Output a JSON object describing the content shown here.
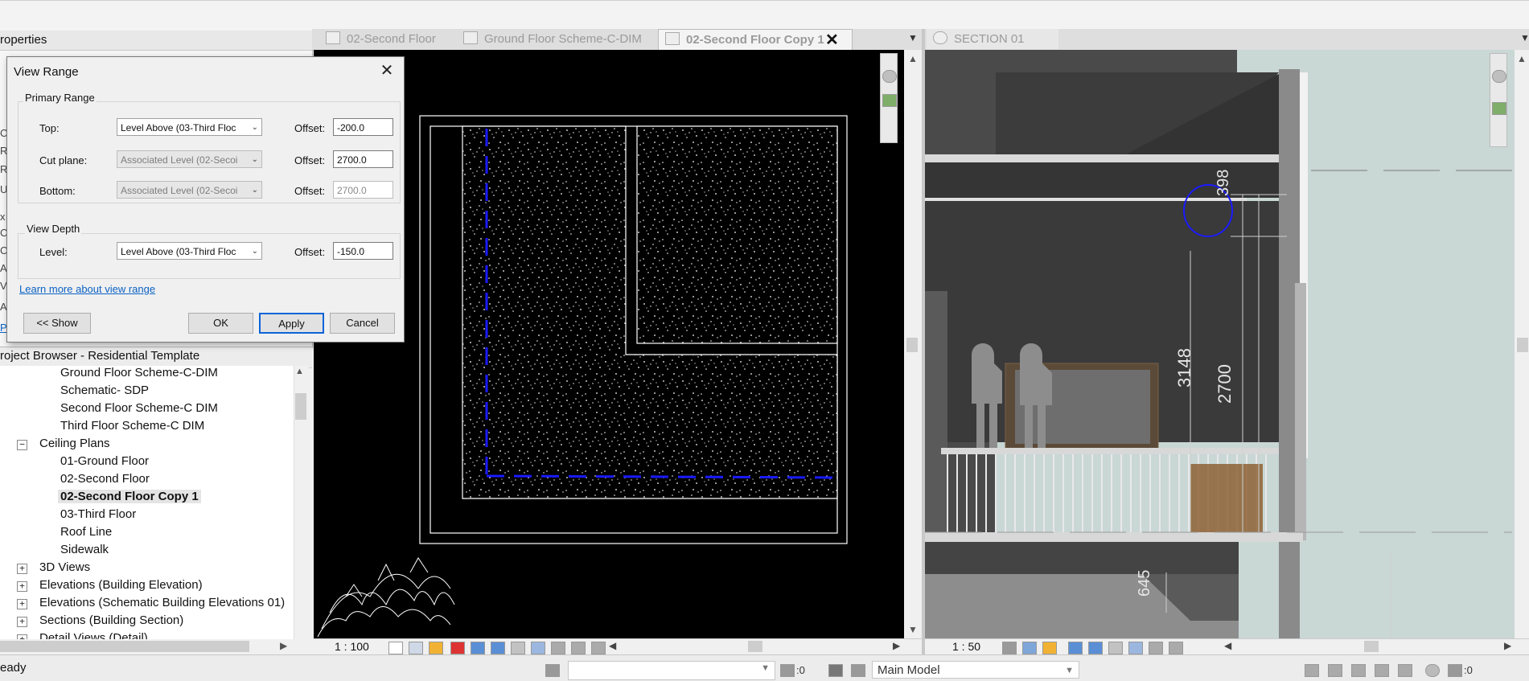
{
  "properties": {
    "title": "roperties",
    "left_letters": [
      "Ce",
      "R",
      "R",
      "U",
      "x",
      "C",
      "C",
      "A",
      "V",
      "A",
      "Pr"
    ]
  },
  "dialog": {
    "title": "View Range",
    "close_glyph": "✕",
    "primary_range": {
      "label": "Primary Range",
      "top": {
        "label": "Top:",
        "level": "Level Above (03-Third Floc",
        "offset_label": "Offset:",
        "offset": "-200.0"
      },
      "cut_plane": {
        "label": "Cut plane:",
        "level": "Associated Level (02-Secoi",
        "offset_label": "Offset:",
        "offset": "2700.0"
      },
      "bottom": {
        "label": "Bottom:",
        "level": "Associated Level (02-Secoi",
        "offset_label": "Offset:",
        "offset": "2700.0"
      }
    },
    "view_depth": {
      "label": "View Depth",
      "level": {
        "label": "Level:",
        "level": "Level Above (03-Third Floc",
        "offset_label": "Offset:",
        "offset": "-150.0"
      }
    },
    "learn_more": "Learn more about view range",
    "buttons": {
      "show": "<< Show",
      "ok": "OK",
      "apply": "Apply",
      "cancel": "Cancel"
    }
  },
  "project_browser": {
    "title": "roject Browser - Residential Template",
    "items": [
      {
        "label": "Ground Floor Scheme-C-DIM"
      },
      {
        "label": "Schematic- SDP"
      },
      {
        "label": "Second Floor Scheme-C DIM"
      },
      {
        "label": "Third Floor Scheme-C DIM"
      },
      {
        "label": "Ceiling Plans"
      },
      {
        "label": "01-Ground Floor"
      },
      {
        "label": "02-Second Floor"
      },
      {
        "label": "02-Second Floor Copy 1"
      },
      {
        "label": "03-Third Floor"
      },
      {
        "label": "Roof Line"
      },
      {
        "label": "Sidewalk"
      },
      {
        "label": "3D Views"
      },
      {
        "label": "Elevations (Building Elevation)"
      },
      {
        "label": "Elevations (Schematic Building Elevations 01)"
      },
      {
        "label": "Sections (Building Section)"
      },
      {
        "label": "Detail Views (Detail)"
      }
    ]
  },
  "tabs": [
    {
      "label": "02-Second Floor"
    },
    {
      "label": "Ground Floor Scheme-C-DIM"
    },
    {
      "label": "02-Second Floor Copy 1"
    },
    {
      "label": "SECTION 01"
    }
  ],
  "tab_close_glyph": "✕",
  "plan_view": {
    "scale": "1 : 100"
  },
  "section_view": {
    "scale": "1 : 50",
    "dimensions": [
      "398",
      "3148",
      "2700",
      "645"
    ]
  },
  "status_bar": {
    "text": "eady",
    "count_a": ":0",
    "model": "Main Model",
    "filter_count": ":0"
  },
  "colors": {
    "accent": "#0a64d8",
    "link": "#0b62c4",
    "markup": "#1a1aff"
  }
}
